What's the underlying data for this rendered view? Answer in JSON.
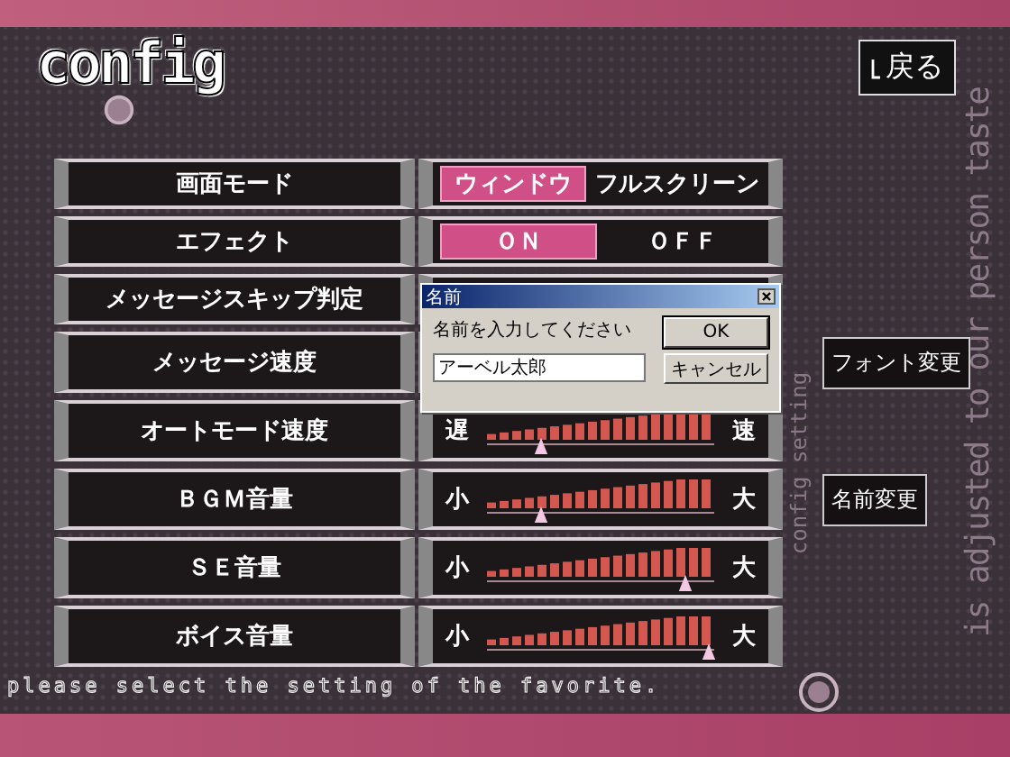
{
  "header": {
    "logo": "config",
    "back_button": "戻る"
  },
  "side_text": [
    "is adjusted to our person taste",
    "config setting"
  ],
  "settings": [
    {
      "label": "画面モード",
      "control": {
        "kind": "options",
        "options": [
          {
            "label": "ウィンドウ",
            "selected": true
          },
          {
            "label": "フルスクリーン",
            "selected": false
          }
        ]
      }
    },
    {
      "label": "エフェクト",
      "control": {
        "kind": "options",
        "options": [
          {
            "label": "ＯＮ",
            "selected": true
          },
          {
            "label": "ＯＦＦ",
            "selected": false
          }
        ]
      }
    },
    {
      "label": "メッセージスキップ判定"
    },
    {
      "label": "メッセージ速度",
      "side_button": "フォント変更"
    },
    {
      "label": "オートモード速度",
      "control": {
        "kind": "slider",
        "min_label": "遅",
        "max_label": "速",
        "level": 0.24
      }
    },
    {
      "label": "ＢＧＭ音量",
      "control": {
        "kind": "slider",
        "min_label": "小",
        "max_label": "大",
        "level": 0.24
      },
      "side_button": "名前変更"
    },
    {
      "label": "ＳＥ音量",
      "control": {
        "kind": "slider",
        "min_label": "小",
        "max_label": "大",
        "level": 0.87
      }
    },
    {
      "label": "ボイス音量",
      "control": {
        "kind": "slider",
        "min_label": "小",
        "max_label": "大",
        "level": 0.98
      }
    }
  ],
  "dialog": {
    "title": "名前",
    "prompt": "名前を入力してください",
    "value": "アーベル太郎",
    "buttons": [
      "OK",
      "キャンセル"
    ]
  },
  "footer": "please select the setting of the favorite."
}
